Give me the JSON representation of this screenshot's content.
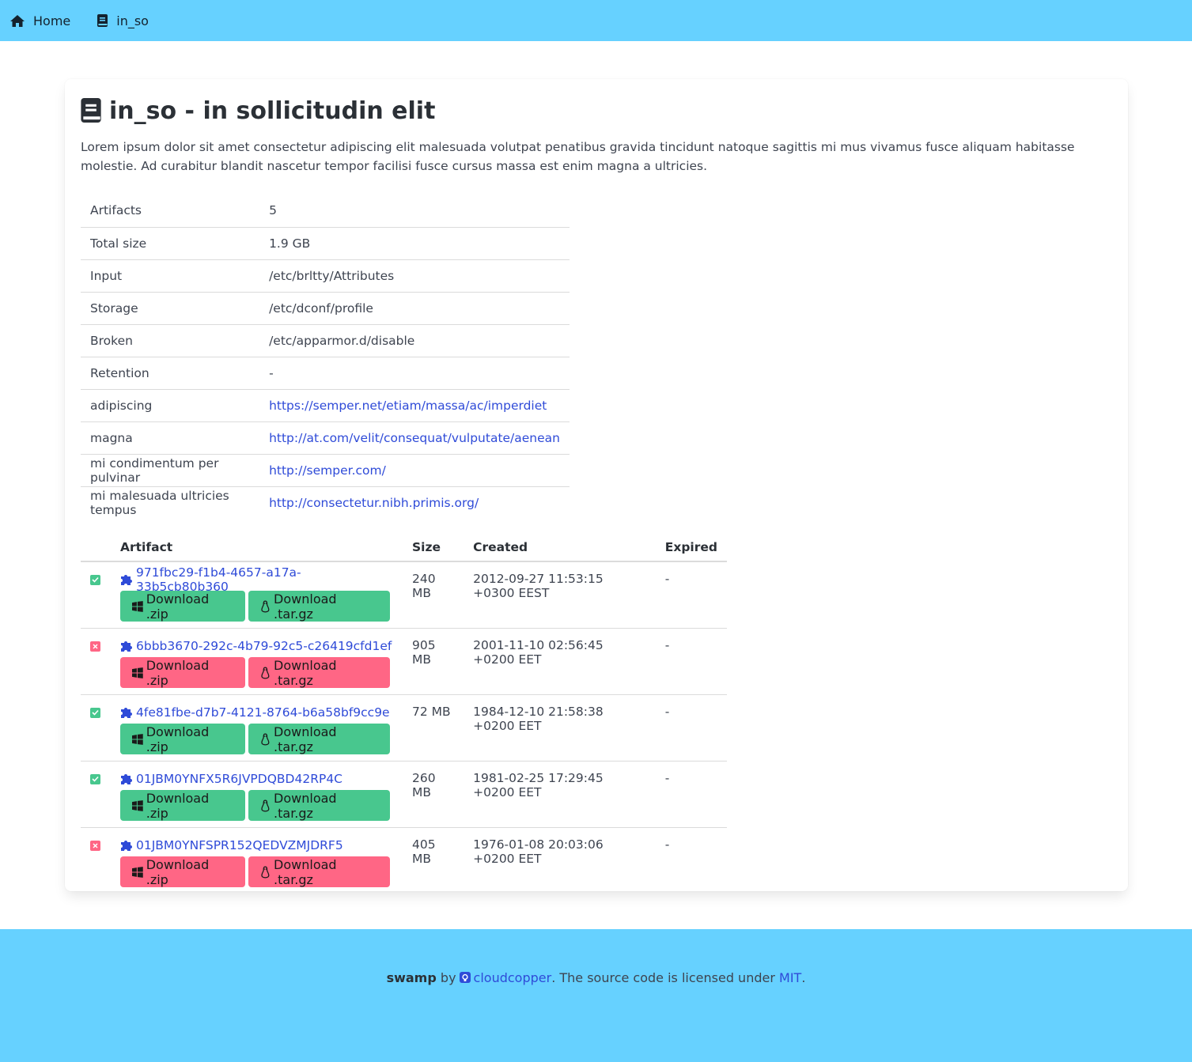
{
  "nav": {
    "home": "Home",
    "current": "in_so"
  },
  "project": {
    "title": "in_so - in sollicitudin elit",
    "description": "Lorem ipsum dolor sit amet consectetur adipiscing elit malesuada volutpat penatibus gravida tincidunt natoque sagittis mi mus vivamus fusce aliquam habitasse molestie. Ad curabitur blandit nascetur tempor facilisi fusce cursus massa est enim magna a ultricies."
  },
  "info": [
    {
      "key": "Artifacts",
      "value": "5"
    },
    {
      "key": "Total size",
      "value": "1.9 GB"
    },
    {
      "key": "Input",
      "value": "/etc/brltty/Attributes"
    },
    {
      "key": "Storage",
      "value": "/etc/dconf/profile"
    },
    {
      "key": "Broken",
      "value": "/etc/apparmor.d/disable"
    },
    {
      "key": "Retention",
      "value": "-"
    },
    {
      "key": "adipiscing",
      "value": "https://semper.net/etiam/massa/ac/imperdiet"
    },
    {
      "key": "magna",
      "value": "http://at.com/velit/consequat/vulputate/aenean"
    },
    {
      "key": "mi condimentum per pulvinar",
      "value": "http://semper.com/"
    },
    {
      "key": "mi malesuada ultricies tempus",
      "value": "http://consectetur.nibh.primis.org/"
    }
  ],
  "artifacts_table": {
    "headers": {
      "artifact": "Artifact",
      "size": "Size",
      "created": "Created",
      "expired": "Expired"
    },
    "zip_label": "Download .zip",
    "tar_label": "Download .tar.gz",
    "rows": [
      {
        "status": "ok",
        "id": "971fbc29-f1b4-4657-a17a-33b5cb80b360",
        "size": "240 MB",
        "created": "2012-09-27 11:53:15 +0300 EEST",
        "expired": "-"
      },
      {
        "status": "bad",
        "id": "6bbb3670-292c-4b79-92c5-c26419cfd1ef",
        "size": "905 MB",
        "created": "2001-11-10 02:56:45 +0200 EET",
        "expired": "-"
      },
      {
        "status": "ok",
        "id": "4fe81fbe-d7b7-4121-8764-b6a58bf9cc9e",
        "size": "72 MB",
        "created": "1984-12-10 21:58:38 +0200 EET",
        "expired": "-"
      },
      {
        "status": "ok",
        "id": "01JBM0YNFX5R6JVPDQBD42RP4C",
        "size": "260 MB",
        "created": "1981-02-25 17:29:45 +0200 EET",
        "expired": "-"
      },
      {
        "status": "bad",
        "id": "01JBM0YNFSPR152QEDVZMJDRF5",
        "size": "405 MB",
        "created": "1976-01-08 20:03:06 +0200 EET",
        "expired": "-"
      }
    ]
  },
  "footer": {
    "brand": "swamp",
    "by": "by",
    "author": "cloudcopper",
    "license_text": ". The source code is licensed under",
    "license": "MIT",
    "end": "."
  },
  "colors": {
    "navbar": "#66d1ff",
    "success": "#48c78e",
    "danger": "#ff6685",
    "link": "#2f4bd8"
  }
}
